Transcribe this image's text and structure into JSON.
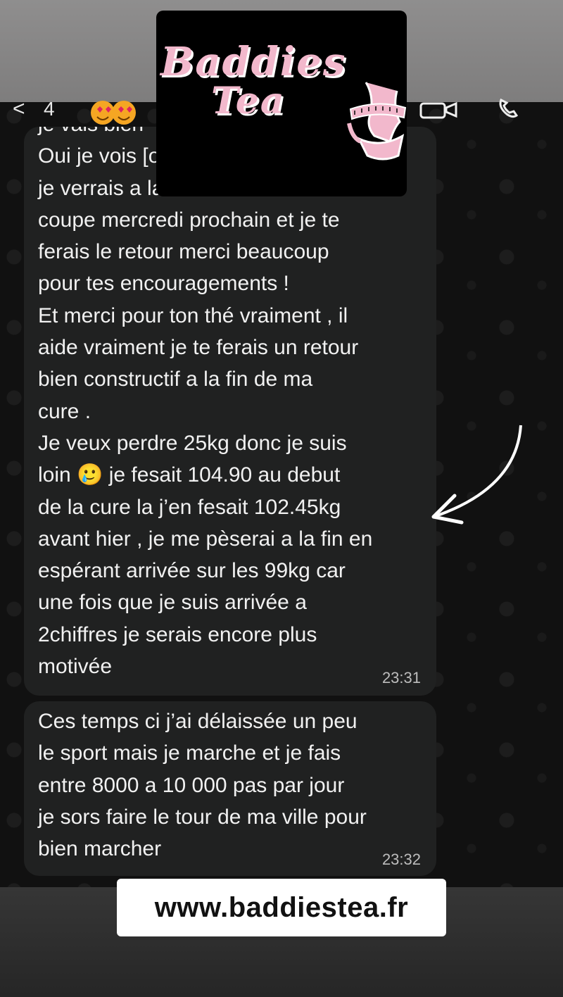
{
  "header": {
    "back_glyph": "<",
    "unread_count": "4",
    "avatar_emoji": "😍😍"
  },
  "logo": {
    "line1": "Baddies",
    "line2": "Tea"
  },
  "messages": [
    {
      "text": "je vais bien\nOui je vois [obscured by logo]\nje verrais a la fin de la cure du\ncoupe mercredi prochain et je te\nferais le retour merci beaucoup\npour tes encouragements !\nEt merci pour ton thé vraiment , il\naide vraiment je te ferais un retour\nbien constructif a la fin de ma\ncure .\nJe veux perdre 25kg donc je suis\nloin 🥲 je fesait 104.90 au debut\nde la cure la j’en fesait 102.45kg\navant hier , je me pèserai a la fin en\nespérant arrivée sur les 99kg car\nune fois que je suis arrivée a\n2chiffres je serais encore plus\nmotivée",
      "time": "23:31"
    },
    {
      "text": "Ces temps ci j’ai délaissée un peu\nle sport mais je marche et je fais\nentre 8000 a 10 000 pas par jour\nje sors faire le tour de ma ville pour\nbien marcher",
      "time": "23:32"
    }
  ],
  "footer": {
    "url": "www.baddiestea.fr"
  },
  "colors": {
    "bubble": "#202121",
    "logo_pink": "#f2b8cc",
    "background": "#111111"
  }
}
